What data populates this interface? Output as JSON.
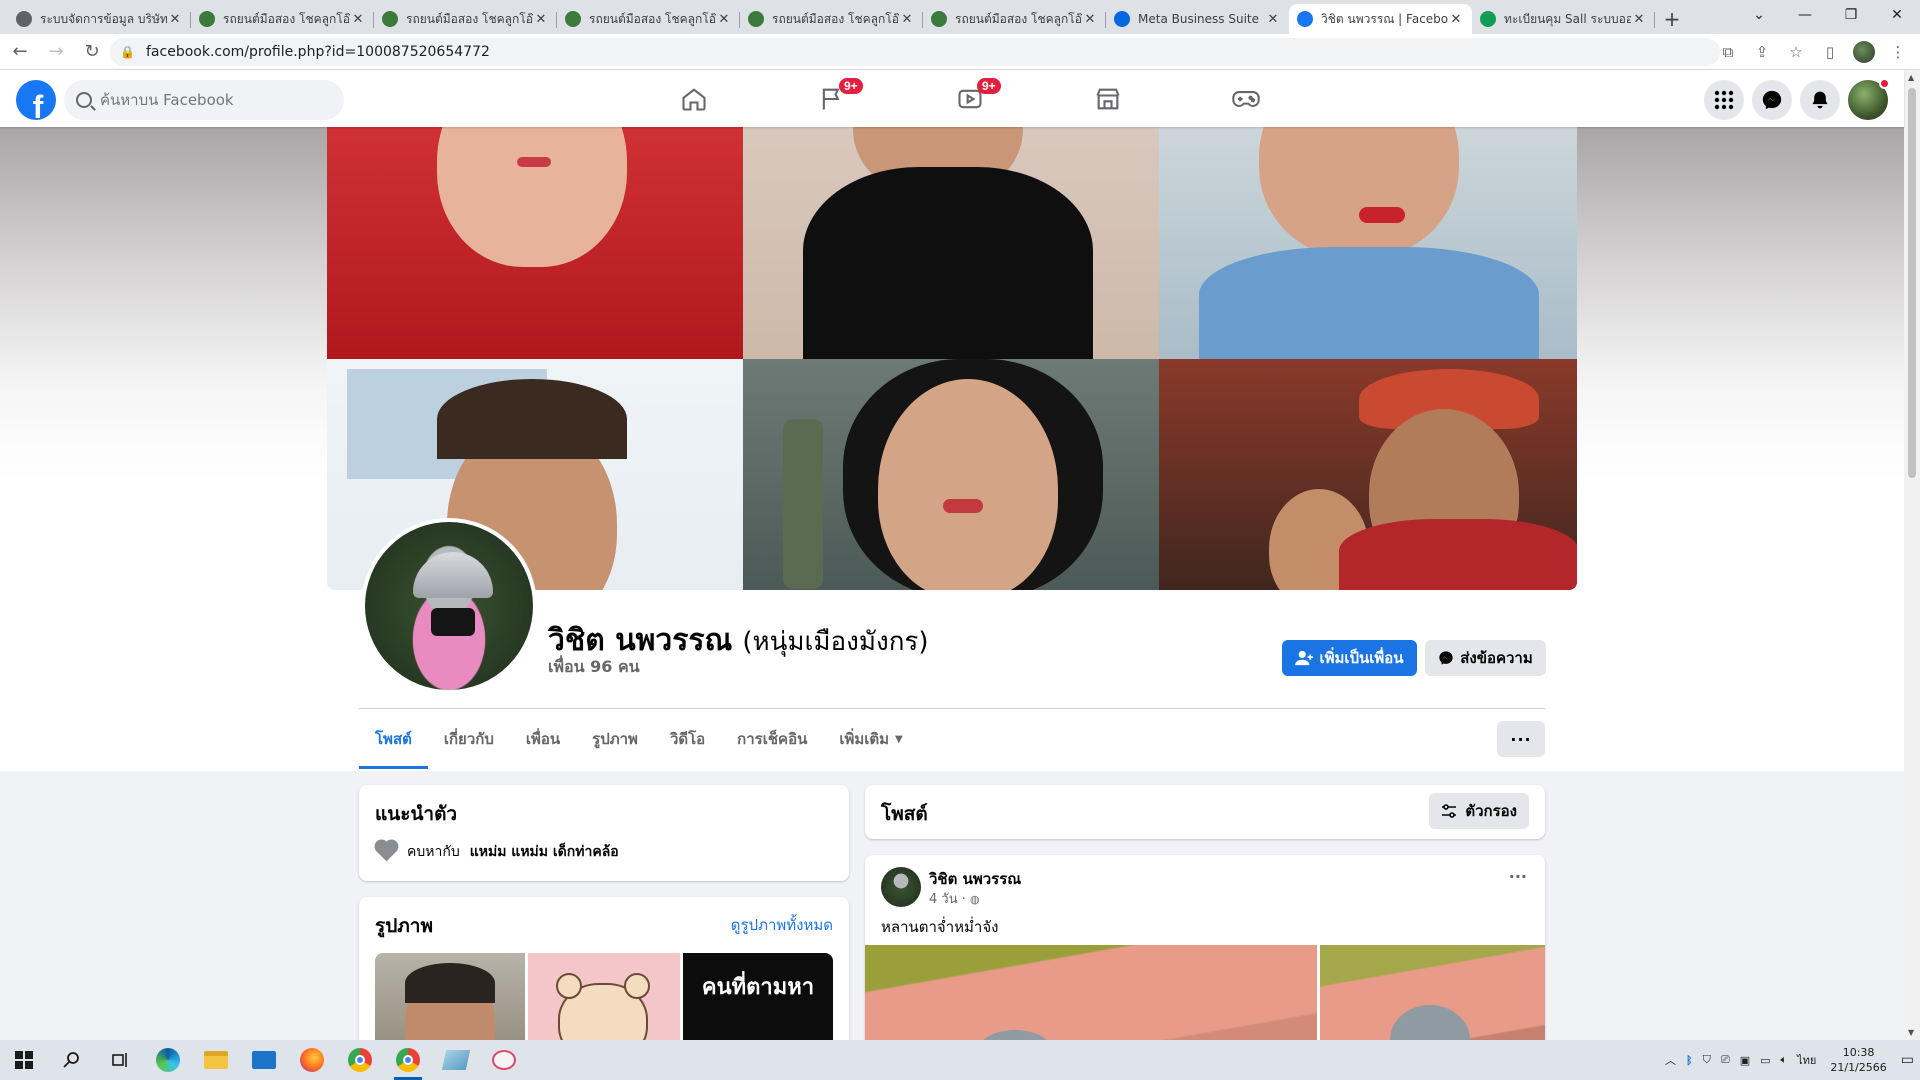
{
  "browser": {
    "tabs": [
      {
        "title": "ระบบจัดการข้อมูล บริษัท โ",
        "icon": "globe-icon",
        "color": "#5f6368"
      },
      {
        "title": "รถยนต์มือสอง โชคลูกโอ๊ค",
        "icon": "site-icon",
        "color": "#3b7a3b"
      },
      {
        "title": "รถยนต์มือสอง โชคลูกโอ๊ค",
        "icon": "site-icon",
        "color": "#3b7a3b"
      },
      {
        "title": "รถยนต์มือสอง โชคลูกโอ๊ค",
        "icon": "site-icon",
        "color": "#3b7a3b"
      },
      {
        "title": "รถยนต์มือสอง โชคลูกโอ๊ค",
        "icon": "site-icon",
        "color": "#3b7a3b"
      },
      {
        "title": "รถยนต์มือสอง โชคลูกโอ๊ค",
        "icon": "site-icon",
        "color": "#3b7a3b"
      },
      {
        "title": "Meta Business Suite",
        "icon": "meta-icon",
        "color": "#0668e1"
      },
      {
        "title": "วิชิต นพวรรณ | Facebook",
        "icon": "facebook-icon",
        "color": "#1877f2",
        "active": true
      },
      {
        "title": "ทะเบียนคุม Sall ระบบออนไลน์",
        "icon": "sheets-icon",
        "color": "#0f9d58"
      }
    ],
    "url": "facebook.com/profile.php?id=100087520654772"
  },
  "fb": {
    "search_placeholder": "ค้นหาบน Facebook",
    "badges": {
      "watch": "9+",
      "video": "9+"
    }
  },
  "profile": {
    "name": "วิชิต นพวรรณ",
    "nickname": "(หนุ่มเมืองมังกร)",
    "friends": "เพื่อน 96 คน",
    "add_friend": "เพิ่มเป็นเพื่อน",
    "message": "ส่งข้อความ",
    "more": "···",
    "tabs": [
      "โพสต์",
      "เกี่ยวกับ",
      "เพื่อน",
      "รูปภาพ",
      "วิดีโอ",
      "การเช็คอิน",
      "เพิ่มเติม"
    ]
  },
  "intro": {
    "title": "แนะนำตัว",
    "relationship_prefix": "คบหากับ",
    "relationship_name": "แหม่ม แหม่ม เด็กท่าคล้อ"
  },
  "photos": {
    "title": "รูปภาพ",
    "see_all": "ดูรูปภาพทั้งหมด",
    "thumb3_text": "คนที่ตามหา"
  },
  "posts": {
    "title": "โพสต์",
    "filter": "ตัวกรอง",
    "items": [
      {
        "author": "วิชิต นพวรรณ",
        "time": "4 วัน ·",
        "text": "หลานตาจ่ำหม่ำจัง"
      }
    ]
  },
  "taskbar": {
    "lang": "ไทย",
    "time": "10:38",
    "date": "21/1/2566"
  }
}
